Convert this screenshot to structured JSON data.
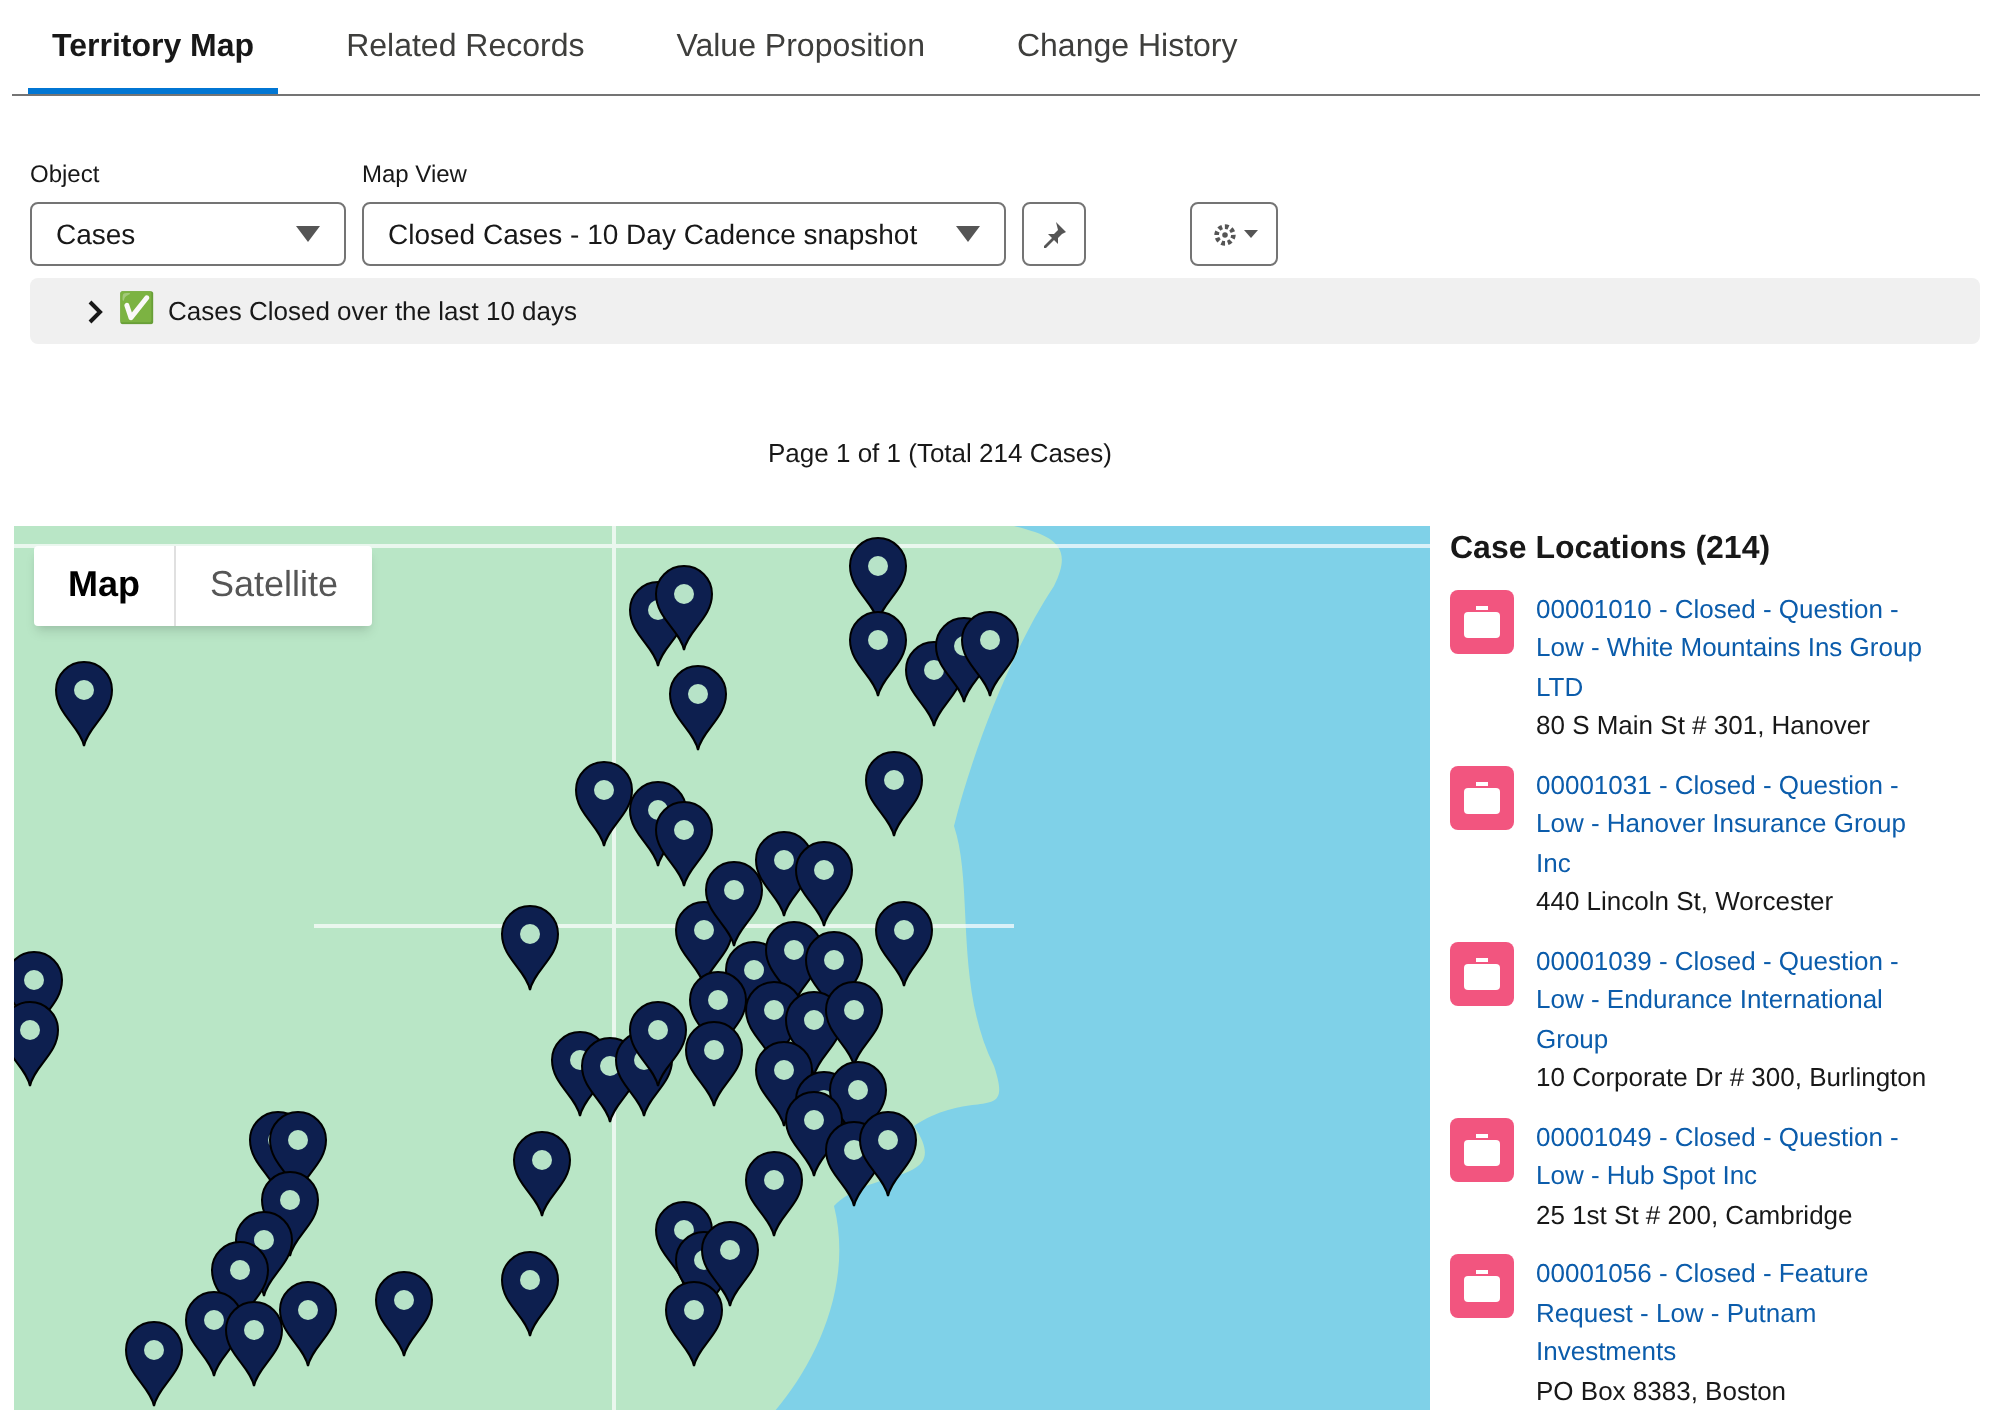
{
  "tabs": [
    {
      "label": "Territory Map",
      "selected": true
    },
    {
      "label": "Related Records",
      "selected": false
    },
    {
      "label": "Value Proposition",
      "selected": false
    },
    {
      "label": "Change History",
      "selected": false
    }
  ],
  "filters": {
    "object": {
      "label": "Object",
      "value": "Cases"
    },
    "map_view": {
      "label": "Map View",
      "value": "Closed Cases - 10 Day Cadence snapshot"
    }
  },
  "summary": {
    "expanded": false,
    "icon": "✅",
    "text": "Cases Closed over the last 10 days"
  },
  "pagination": "Page 1 of 1 (Total 214 Cases)",
  "map": {
    "types": [
      {
        "label": "Map",
        "selected": true
      },
      {
        "label": "Satellite",
        "selected": false
      }
    ]
  },
  "list": {
    "title": "Case Locations (214)",
    "items": [
      {
        "title": "00001010 - Closed - Question - Low - White Mountains Ins Group LTD",
        "address": "80 S Main St # 301, Hanover"
      },
      {
        "title": "00001031 - Closed - Question - Low - Hanover Insurance Group Inc",
        "address": "440 Lincoln St, Worcester"
      },
      {
        "title": "00001039 - Closed - Question - Low - Endurance International Group",
        "address": "10 Corporate Dr # 300, Burlington"
      },
      {
        "title": "00001049 - Closed - Question - Low - Hub Spot Inc",
        "address": "25 1st St # 200, Cambridge"
      },
      {
        "title": "00001056 - Closed - Feature Request - Low - Putnam Investments",
        "address": "PO Box 8383, Boston"
      }
    ]
  }
}
